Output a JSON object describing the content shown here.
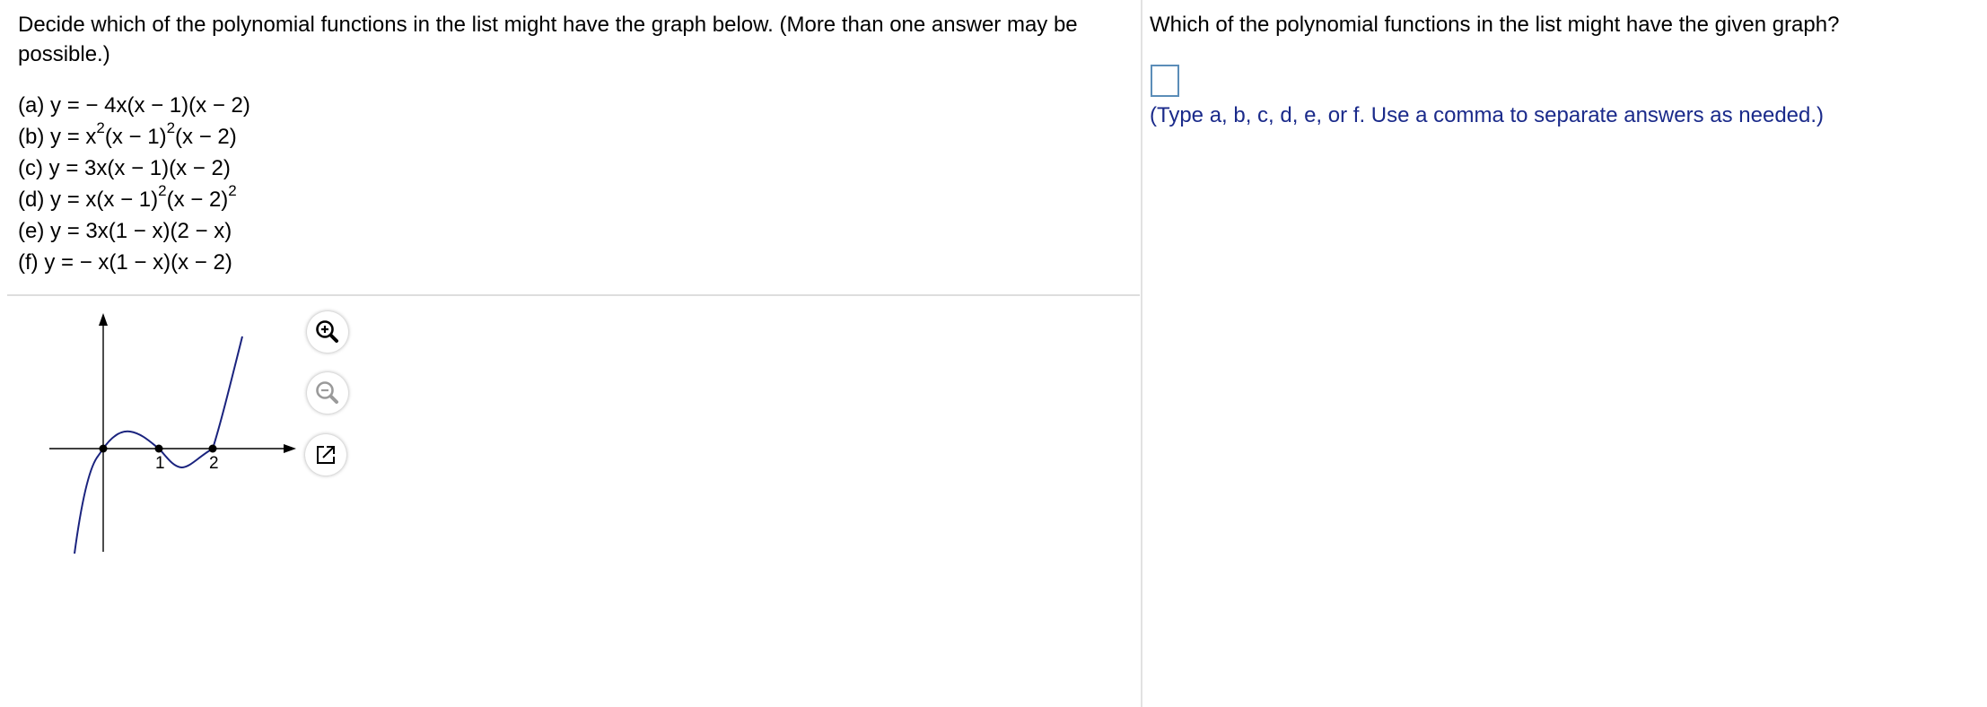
{
  "left": {
    "instructions": "Decide which of the polynomial functions in the list might have the graph below.  (More than one answer may be possible.)",
    "options": [
      {
        "label": "(a) y = − 4x(x − 1)(x − 2)"
      },
      {
        "label": "(b) y = x²(x − 1)²(x − 2)"
      },
      {
        "label": "(c) y = 3x(x − 1)(x − 2)"
      },
      {
        "label": "(d) y = x(x − 1)²(x − 2)²"
      },
      {
        "label": "(e) y = 3x(1 − x)(2 − x)"
      },
      {
        "label": "(f) y = − x(1 − x)(x − 2)"
      }
    ],
    "graph": {
      "x_tick_labels": [
        "1",
        "2"
      ],
      "curve_color": "#1a237e",
      "tools": [
        {
          "name": "zoom-in",
          "icon": "magnifier-plus-icon"
        },
        {
          "name": "zoom-out",
          "icon": "magnifier-minus-icon"
        },
        {
          "name": "pop-out",
          "icon": "external-link-icon"
        }
      ]
    }
  },
  "right": {
    "question": "Which of the polynomial functions in the list might have the given graph?",
    "answer_value": "",
    "hint": "(Type a, b, c, d, e, or f. Use a comma to separate answers as needed.)",
    "hint_color": "#1a2a8a",
    "answer_border_color": "#5b8db8"
  }
}
